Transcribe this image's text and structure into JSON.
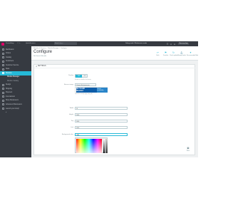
{
  "topbar": {
    "brand": "PrestaShop",
    "version": "1.7.x",
    "quick_access": "Quick Access ▾",
    "search_placeholder": "Search (e.g. ...",
    "notice": "Debug mode / Maintenance mode",
    "shop_button": "View my shop",
    "icons": [
      "cart-icon",
      "user-icon",
      "bell-icon",
      "help-icon"
    ]
  },
  "sidebar": {
    "items": [
      {
        "label": "Dashboard",
        "state": "normal"
      },
      {
        "label": "Orders",
        "state": "normal"
      },
      {
        "label": "Catalog",
        "state": "normal"
      },
      {
        "label": "Customers",
        "state": "normal"
      },
      {
        "label": "Customer Service",
        "state": "normal"
      },
      {
        "label": "Stats",
        "state": "normal"
      },
      {
        "label": "Modules",
        "state": "active"
      },
      {
        "label": "Module Manager",
        "state": "sub-active"
      },
      {
        "label": "Module Catalog",
        "state": "sub"
      },
      {
        "label": "Design",
        "state": "normal"
      },
      {
        "label": "Shipping",
        "state": "normal"
      },
      {
        "label": "Payment",
        "state": "normal"
      },
      {
        "label": "International",
        "state": "normal"
      },
      {
        "label": "Shop Parameters",
        "state": "normal"
      },
      {
        "label": "Advanced Parameters",
        "state": "normal"
      },
      {
        "label": "Launch your shop!",
        "state": "normal"
      },
      {
        "label": "«",
        "state": "normal"
      }
    ]
  },
  "header": {
    "breadcrumb": [
      "Modules & Services",
      "/",
      "Module Manager",
      "/",
      "Configure"
    ],
    "title": "Configure",
    "subtitle": "No Search Results",
    "toolbar": [
      {
        "label": "Back",
        "icon": "back-icon"
      },
      {
        "label": "Translate",
        "icon": "flag-icon"
      },
      {
        "label": "Check update",
        "icon": "refresh-icon"
      },
      {
        "label": "Manage hooks",
        "icon": "anchor-icon"
      },
      {
        "label": "Recommended Modules",
        "icon": "puzzle-icon"
      }
    ]
  },
  "panel": {
    "heading": "Settings",
    "fields": {
      "enable": {
        "label": "Display",
        "on": "YES",
        "off": "NO",
        "value": "YES",
        "help": "Enable or disable the banner"
      },
      "image": {
        "label": "Banner image",
        "file_text": "Choose file  banner.png",
        "help": "Upload an image (jpg, png, gif)"
      },
      "preview": {
        "line1": "No Credit",
        "line2": "Needed",
        "side": "Check availability"
      },
      "width": {
        "label": "Width",
        "value": "10"
      },
      "height": {
        "label": "Height",
        "value": "1000"
      },
      "top": {
        "label": "Top",
        "value": "1000"
      },
      "link": {
        "label": "Link",
        "value": "1000"
      },
      "bg_color": {
        "label": "Background color",
        "value": "#ffffff"
      }
    },
    "save_label": "Save"
  },
  "colors": {
    "sidebar_bg": "#363a41",
    "accent": "#25b9d7",
    "banner_blue": "#0d5ca8"
  }
}
